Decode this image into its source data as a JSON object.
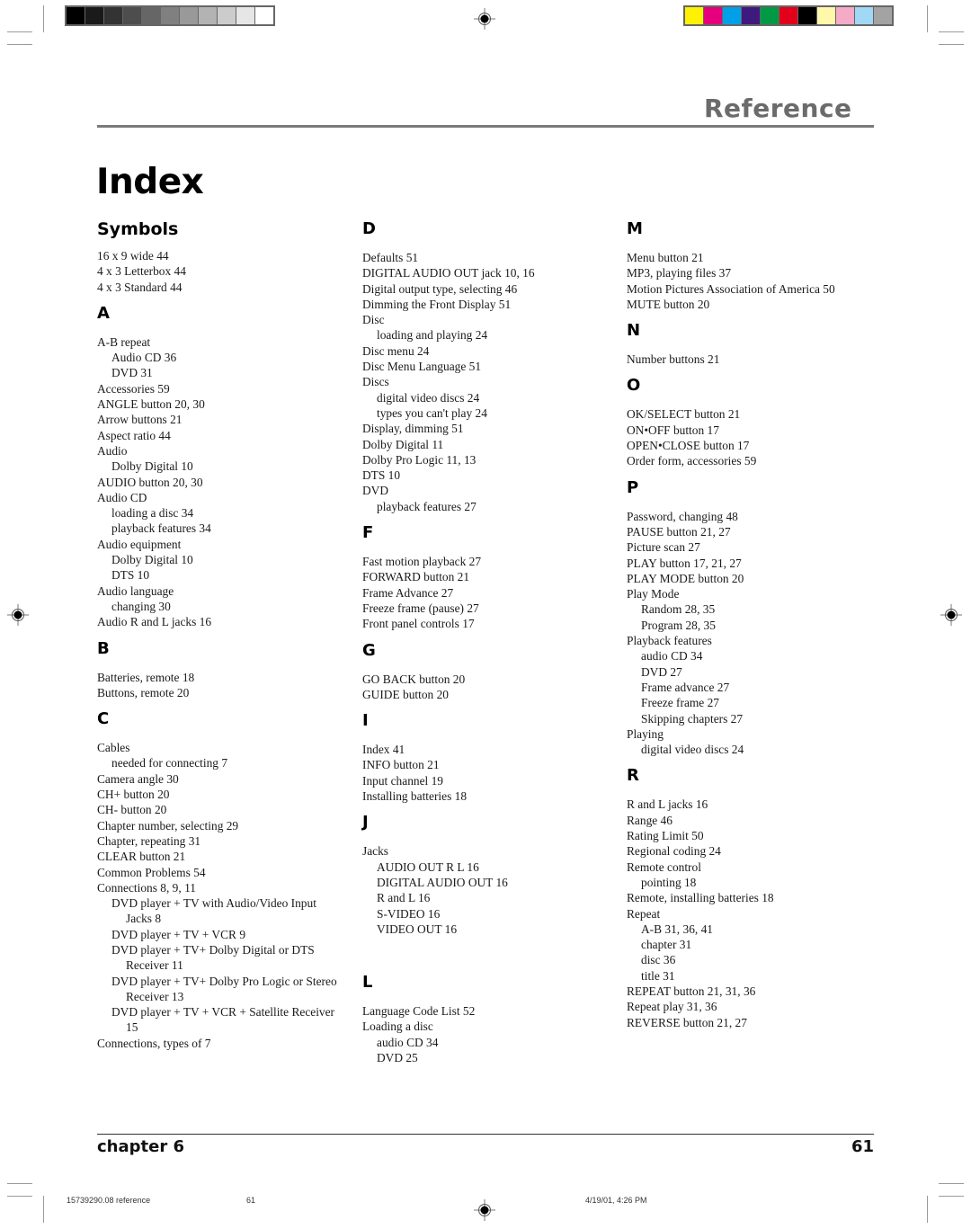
{
  "print_marks": {
    "gray_bar": [
      "#000000",
      "#1a1a1a",
      "#333333",
      "#4d4d4d",
      "#666666",
      "#808080",
      "#999999",
      "#b3b3b3",
      "#cccccc",
      "#e6e6e6",
      "#ffffff"
    ],
    "color_bar": [
      "#fff200",
      "#e6007e",
      "#00a0e9",
      "#3f1a7e",
      "#009a44",
      "#e2001a",
      "#000000",
      "#fff7aa",
      "#f5aac7",
      "#a0d8f5",
      "#a3a3a3"
    ]
  },
  "header": {
    "section": "Reference",
    "title": "Index"
  },
  "columns": [
    {
      "groups": [
        {
          "letter": "Symbols",
          "entries": [
            {
              "text": "16 x 9 wide  44",
              "level": 0
            },
            {
              "text": "4 x 3 Letterbox  44",
              "level": 0
            },
            {
              "text": "4 x 3 Standard  44",
              "level": 0
            }
          ]
        },
        {
          "letter": "A",
          "entries": [
            {
              "text": "A-B repeat",
              "level": 0
            },
            {
              "text": "Audio CD  36",
              "level": 1
            },
            {
              "text": "DVD  31",
              "level": 1
            },
            {
              "text": "Accessories  59",
              "level": 0
            },
            {
              "text": "ANGLE button  20,  30",
              "level": 0
            },
            {
              "text": "Arrow buttons  21",
              "level": 0
            },
            {
              "text": "Aspect ratio  44",
              "level": 0
            },
            {
              "text": "Audio",
              "level": 0
            },
            {
              "text": "Dolby Digital  10",
              "level": 1
            },
            {
              "text": "AUDIO button  20, 30",
              "level": 0
            },
            {
              "text": "Audio CD",
              "level": 0
            },
            {
              "text": "loading a disc  34",
              "level": 1
            },
            {
              "text": "playback features  34",
              "level": 1
            },
            {
              "text": "Audio equipment",
              "level": 0
            },
            {
              "text": "Dolby Digital  10",
              "level": 1
            },
            {
              "text": "DTS  10",
              "level": 1
            },
            {
              "text": "Audio language",
              "level": 0
            },
            {
              "text": "changing  30",
              "level": 1
            },
            {
              "text": "Audio R and L jacks  16",
              "level": 0
            }
          ]
        },
        {
          "letter": "B",
          "entries": [
            {
              "text": "Batteries, remote  18",
              "level": 0
            },
            {
              "text": "Buttons, remote  20",
              "level": 0
            }
          ]
        },
        {
          "letter": "C",
          "entries": [
            {
              "text": "Cables",
              "level": 0
            },
            {
              "text": "needed for connecting  7",
              "level": 1
            },
            {
              "text": "Camera angle  30",
              "level": 0
            },
            {
              "text": "CH+ button   20",
              "level": 0
            },
            {
              "text": "CH- button   20",
              "level": 0
            },
            {
              "text": "Chapter number, selecting  29",
              "level": 0
            },
            {
              "text": "Chapter, repeating  31",
              "level": 0
            },
            {
              "text": "CLEAR button  21",
              "level": 0
            },
            {
              "text": "Common Problems  54",
              "level": 0
            },
            {
              "text": "Connections  8,  9,  11",
              "level": 0
            },
            {
              "text": "DVD player + TV with Audio/Video Input",
              "level": 1
            },
            {
              "text": "Jacks  8",
              "level": 2
            },
            {
              "text": "DVD player + TV + VCR  9",
              "level": 1
            },
            {
              "text": "DVD player + TV+ Dolby Digital or DTS",
              "level": 1
            },
            {
              "text": "Receiver  11",
              "level": 2
            },
            {
              "text": "DVD player + TV+ Dolby Pro Logic or Stereo",
              "level": 1
            },
            {
              "text": "Receiver  13",
              "level": 2
            },
            {
              "text": "DVD player + TV + VCR + Satellite Receiver",
              "level": 1
            },
            {
              "text": "15",
              "level": 2
            },
            {
              "text": "Connections, types of  7",
              "level": 0
            }
          ]
        }
      ]
    },
    {
      "groups": [
        {
          "letter": "D",
          "entries": [
            {
              "text": "Defaults  51",
              "level": 0
            },
            {
              "text": "DIGITAL AUDIO OUT jack  10,  16",
              "level": 0
            },
            {
              "text": "Digital output type, selecting  46",
              "level": 0
            },
            {
              "text": "Dimming the Front Display  51",
              "level": 0
            },
            {
              "text": "Disc",
              "level": 0
            },
            {
              "text": "loading and playing  24",
              "level": 1
            },
            {
              "text": "Disc menu  24",
              "level": 0
            },
            {
              "text": "Disc Menu Language  51",
              "level": 0
            },
            {
              "text": "Discs",
              "level": 0
            },
            {
              "text": "digital video discs  24",
              "level": 1
            },
            {
              "text": "types you can't play  24",
              "level": 1
            },
            {
              "text": "Display, dimming   51",
              "level": 0
            },
            {
              "text": "Dolby Digital  11",
              "level": 0
            },
            {
              "text": "Dolby Pro Logic  11,  13",
              "level": 0
            },
            {
              "text": "DTS  10",
              "level": 0
            },
            {
              "text": "DVD",
              "level": 0
            },
            {
              "text": "playback features  27",
              "level": 1
            }
          ]
        },
        {
          "letter": "F",
          "entries": [
            {
              "text": "Fast motion playback  27",
              "level": 0
            },
            {
              "text": "FORWARD button  21",
              "level": 0
            },
            {
              "text": "Frame Advance  27",
              "level": 0
            },
            {
              "text": "Freeze frame (pause)  27",
              "level": 0
            },
            {
              "text": "Front panel controls  17",
              "level": 0
            }
          ]
        },
        {
          "letter": "G",
          "entries": [
            {
              "text": "GO BACK button  20",
              "level": 0
            },
            {
              "text": "GUIDE button  20",
              "level": 0
            }
          ]
        },
        {
          "letter": "I",
          "entries": [
            {
              "text": "Index  41",
              "level": 0
            },
            {
              "text": "INFO button  21",
              "level": 0
            },
            {
              "text": "Input channel  19",
              "level": 0
            },
            {
              "text": "Installing batteries  18",
              "level": 0
            }
          ]
        },
        {
          "letter": "J",
          "entries": [
            {
              "text": "Jacks",
              "level": 0
            },
            {
              "text": "AUDIO OUT R L  16",
              "level": 1
            },
            {
              "text": "DIGITAL AUDIO OUT  16",
              "level": 1
            },
            {
              "text": "R and L  16",
              "level": 1
            },
            {
              "text": "S-VIDEO  16",
              "level": 1
            },
            {
              "text": "VIDEO OUT  16",
              "level": 1
            }
          ],
          "extra_gap": true
        },
        {
          "letter": "L",
          "entries": [
            {
              "text": "Language Code List   52",
              "level": 0
            },
            {
              "text": "Loading a disc",
              "level": 0
            },
            {
              "text": "audio CD  34",
              "level": 1
            },
            {
              "text": "DVD  25",
              "level": 1
            }
          ]
        }
      ]
    },
    {
      "groups": [
        {
          "letter": "M",
          "entries": [
            {
              "text": "Menu button   21",
              "level": 0
            },
            {
              "text": "MP3, playing files  37",
              "level": 0
            },
            {
              "text": "Motion Pictures Association of America  50",
              "level": 0
            },
            {
              "text": "MUTE button   20",
              "level": 0
            }
          ]
        },
        {
          "letter": "N",
          "entries": [
            {
              "text": "Number buttons  21",
              "level": 0
            }
          ]
        },
        {
          "letter": "O",
          "entries": [
            {
              "text": "OK/SELECT button  21",
              "level": 0
            },
            {
              "text": "ON•OFF button  17",
              "level": 0
            },
            {
              "text": "OPEN•CLOSE button  17",
              "level": 0
            },
            {
              "text": "Order form, accessories  59",
              "level": 0
            }
          ]
        },
        {
          "letter": "P",
          "entries": [
            {
              "text": "Password, changing  48",
              "level": 0
            },
            {
              "text": "PAUSE button  21, 27",
              "level": 0
            },
            {
              "text": "Picture scan  27",
              "level": 0
            },
            {
              "text": "PLAY button  17, 21, 27",
              "level": 0
            },
            {
              "text": "PLAY MODE button  20",
              "level": 0
            },
            {
              "text": "Play Mode",
              "level": 0
            },
            {
              "text": "Random  28, 35",
              "level": 1
            },
            {
              "text": "Program  28, 35",
              "level": 1
            },
            {
              "text": "Playback features",
              "level": 0
            },
            {
              "text": "audio CD  34",
              "level": 1
            },
            {
              "text": "DVD  27",
              "level": 1
            },
            {
              "text": "Frame advance  27",
              "level": 1
            },
            {
              "text": "Freeze frame  27",
              "level": 1
            },
            {
              "text": "Skipping chapters  27",
              "level": 1
            },
            {
              "text": "Playing",
              "level": 0
            },
            {
              "text": "digital video discs  24",
              "level": 1
            }
          ]
        },
        {
          "letter": "R",
          "entries": [
            {
              "text": "R and L jacks  16",
              "level": 0
            },
            {
              "text": "Range 46",
              "level": 0
            },
            {
              "text": "Rating Limit  50",
              "level": 0
            },
            {
              "text": "Regional coding  24",
              "level": 0
            },
            {
              "text": "Remote control",
              "level": 0
            },
            {
              "text": "pointing  18",
              "level": 1
            },
            {
              "text": "Remote, installing batteries  18",
              "level": 0
            },
            {
              "text": "Repeat",
              "level": 0
            },
            {
              "text": "A-B  31,  36, 41",
              "level": 1
            },
            {
              "text": "chapter  31",
              "level": 1
            },
            {
              "text": "disc   36",
              "level": 1
            },
            {
              "text": "title  31",
              "level": 1
            },
            {
              "text": "REPEAT button  21,  31,  36",
              "level": 0
            },
            {
              "text": "Repeat play  31, 36",
              "level": 0
            },
            {
              "text": "REVERSE button  21, 27",
              "level": 0
            }
          ]
        }
      ]
    }
  ],
  "footer": {
    "chapter": "chapter 6",
    "page": "61"
  },
  "slug": {
    "file": "15739290.08 reference",
    "page": "61",
    "datetime": "4/19/01, 4:26 PM"
  }
}
